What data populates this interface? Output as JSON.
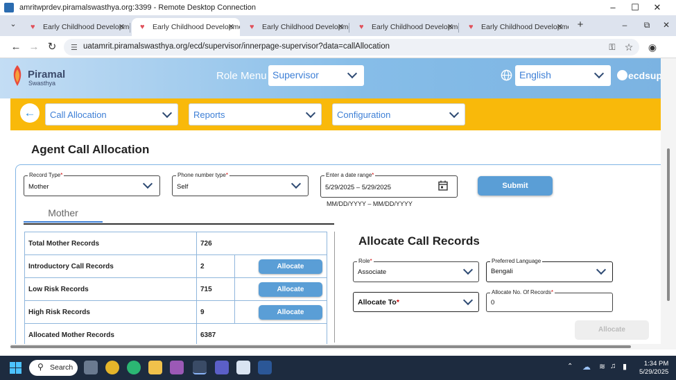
{
  "rdp": {
    "title": "amritwprdev.piramalswasthya.org:3399 - Remote Desktop Connection"
  },
  "browser": {
    "tabs": [
      {
        "label": "Early Childhood Developme"
      },
      {
        "label": "Early Childhood Developme"
      },
      {
        "label": "Early Childhood Developme"
      },
      {
        "label": "Early Childhood Developme"
      },
      {
        "label": "Early Childhood Developme"
      }
    ],
    "url": "uatamrit.piramalswasthya.org/ecd/supervisor/innerpage-supervisor?data=callAllocation"
  },
  "header": {
    "logo_name": "Piramal",
    "logo_sub": "Swasthya",
    "role_menu_label": "Role Menu :",
    "role_value": "Supervisor",
    "language_value": "English",
    "user_name": "ecdsupe"
  },
  "menu": {
    "back_glyph": "←",
    "items": [
      {
        "label": "Call Allocation"
      },
      {
        "label": "Reports"
      },
      {
        "label": "Configuration"
      }
    ]
  },
  "page": {
    "title": "Agent Call Allocation",
    "filters": {
      "record_type_label": "Record Type",
      "record_type_value": "Mother",
      "phone_type_label": "Phone number type",
      "phone_type_value": "Self",
      "date_range_label": "Enter a date range",
      "date_range_value": "5/29/2025 – 5/29/2025",
      "date_hint": "MM/DD/YYYY – MM/DD/YYYY",
      "required_mark": "*"
    },
    "submit_label": "Submit",
    "tab_label": "Mother",
    "records": [
      {
        "label": "Total Mother Records",
        "value": "726"
      },
      {
        "label": "Introductory Call Records",
        "value": "2",
        "action": "Allocate"
      },
      {
        "label": "Low Risk Records",
        "value": "715",
        "action": "Allocate"
      },
      {
        "label": "High Risk Records",
        "value": "9",
        "action": "Allocate"
      },
      {
        "label": "Allocated Mother Records",
        "value": "6387"
      }
    ],
    "allocate": {
      "title": "Allocate Call Records",
      "role_label": "Role",
      "role_value": "Associate",
      "preferred_language_label": "Preferred Language",
      "preferred_language_value": "Bengali",
      "allocate_to_placeholder": "Allocate To",
      "no_of_records_label": "Allocate No. Of Records",
      "no_of_records_value": "0",
      "button_label": "Allocate"
    }
  },
  "taskbar": {
    "search_label": "Search",
    "time": "1:34 PM",
    "date": "5/29/2025"
  },
  "colors": {
    "menu_bar": "#f9b90a",
    "primary_button": "#5a9ed6",
    "link_blue": "#3d7fd6"
  }
}
